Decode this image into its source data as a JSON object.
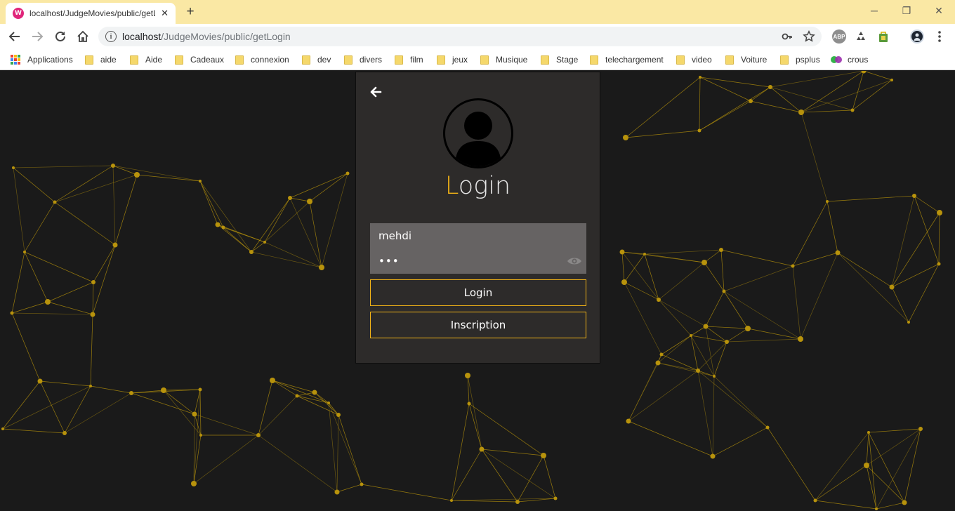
{
  "browser": {
    "tab": {
      "title": "localhost/JudgeMovies/public/getLogin",
      "favicon_letter": "W",
      "close": "✕"
    },
    "new_tab": "+",
    "window_controls": {
      "minimize": "─",
      "restore": "❐",
      "close": "✕"
    },
    "url": {
      "host": "localhost",
      "path": "/JudgeMovies/public/getLogin"
    },
    "extensions": {
      "abp": "ABP"
    },
    "bookmarks": [
      {
        "label": "Applications",
        "type": "apps"
      },
      {
        "label": "aide",
        "type": "folder"
      },
      {
        "label": "Aide",
        "type": "folder"
      },
      {
        "label": "Cadeaux",
        "type": "folder"
      },
      {
        "label": "connexion",
        "type": "folder"
      },
      {
        "label": "dev",
        "type": "folder"
      },
      {
        "label": "divers",
        "type": "folder"
      },
      {
        "label": "film",
        "type": "folder"
      },
      {
        "label": "jeux",
        "type": "folder"
      },
      {
        "label": "Musique",
        "type": "folder"
      },
      {
        "label": "Stage",
        "type": "folder"
      },
      {
        "label": "telechargement",
        "type": "folder"
      },
      {
        "label": "video",
        "type": "folder"
      },
      {
        "label": "Voiture",
        "type": "folder"
      },
      {
        "label": "psplus",
        "type": "folder"
      },
      {
        "label": "crous",
        "type": "site"
      }
    ]
  },
  "login": {
    "title_first_letter": "L",
    "title_rest": "ogin",
    "username_value": "mehdi",
    "password_value": "•••",
    "login_button": "Login",
    "signup_button": "Inscription"
  },
  "colors": {
    "accent": "#f3b416",
    "card_bg": "#2d2b2a",
    "page_bg": "#1a1a1a",
    "field_bg": "#666363",
    "network": "#b8930c"
  },
  "icons": {
    "back": "arrow-left-icon",
    "avatar": "user-avatar-icon",
    "eye": "eye-icon",
    "key": "key-icon",
    "star": "star-icon",
    "info": "info-icon"
  }
}
